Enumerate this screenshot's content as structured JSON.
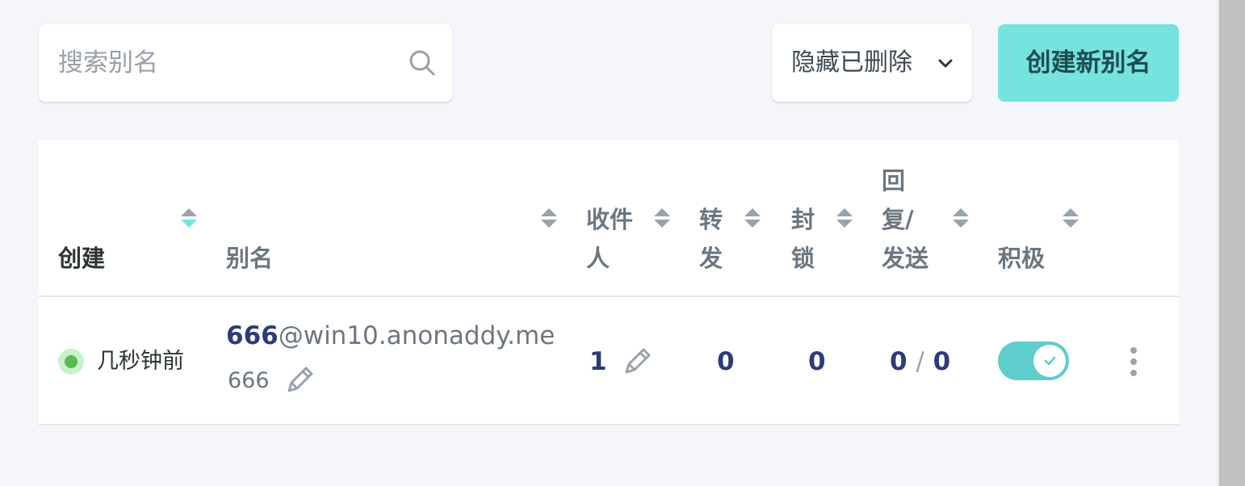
{
  "search": {
    "placeholder": "搜索别名",
    "icon": "search-icon"
  },
  "filter": {
    "selected": "隐藏已删除",
    "icon": "chevron-down-icon"
  },
  "create_button": {
    "label": "创建新别名"
  },
  "table": {
    "headers": {
      "created": "创建",
      "alias": "别名",
      "recipients_line1": "收件",
      "recipients_line2": "人",
      "forwarded_line1": "转",
      "forwarded_line2": "发",
      "blocked_line1": "封",
      "blocked_line2": "锁",
      "replies_line1": "回",
      "replies_line2": "复/",
      "replies_line3": "发送",
      "active": "积极"
    },
    "rows": [
      {
        "created": "几秒钟前",
        "alias_local": "666",
        "alias_domain": "@win10.anonaddy.me",
        "description": "666",
        "recipients": "1",
        "forwarded": "0",
        "blocked": "0",
        "replies": "0",
        "slash": "/",
        "sent": "0",
        "active": true
      }
    ]
  },
  "colors": {
    "accent": "#76e3de",
    "toggle_on": "#5fcdcb",
    "numbers": "#2e3b78",
    "status_dot": "#5bb955"
  }
}
